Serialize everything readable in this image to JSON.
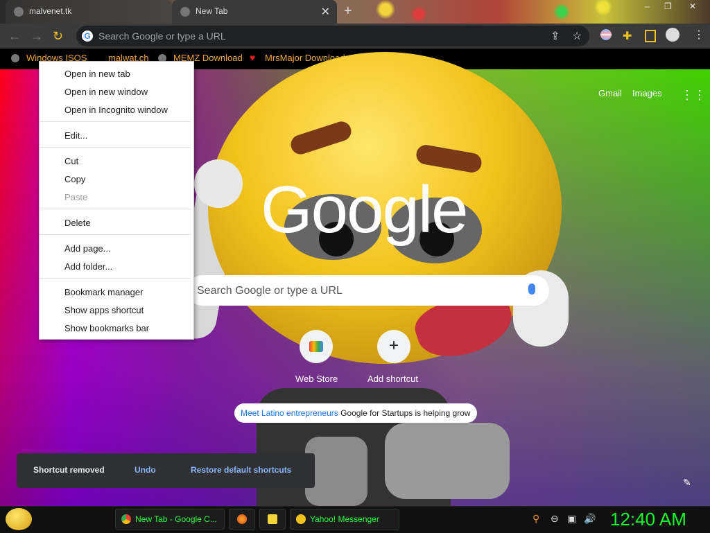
{
  "window": {
    "tabs": [
      {
        "title": "malvenet.tk"
      },
      {
        "title": "New Tab"
      }
    ],
    "new_tab_symbol": "+",
    "close_symbol": "✕",
    "controls": {
      "minimize": "–",
      "maximize": "❐",
      "close": "✕"
    }
  },
  "toolbar": {
    "back": "←",
    "forward": "→",
    "reload": "↻",
    "omnibox_placeholder": "Search Google or type a URL",
    "omnibox_g": "G"
  },
  "bookmarks": [
    {
      "label": "Windows ISOS"
    },
    {
      "label": "malwat.ch"
    },
    {
      "label": "MEMZ Download"
    },
    {
      "label": "MrsMajor Download"
    }
  ],
  "ntp": {
    "header_links": [
      "Gmail",
      "Images"
    ],
    "logo": "Google",
    "search_placeholder": "Search Google or type a URL",
    "shortcuts": [
      {
        "label": "Web Store"
      },
      {
        "label": "Add shortcut"
      }
    ],
    "add_symbol": "+",
    "promo": {
      "link": "Meet Latino entrepreneurs",
      "text": "Google for Startups is helping grow"
    }
  },
  "toast": {
    "message": "Shortcut removed",
    "undo": "Undo",
    "restore": "Restore default shortcuts"
  },
  "context_menu": {
    "groups": [
      [
        {
          "label": "Open in new tab"
        },
        {
          "label": "Open in new window"
        },
        {
          "label": "Open in Incognito window"
        }
      ],
      [
        {
          "label": "Edit..."
        }
      ],
      [
        {
          "label": "Cut"
        },
        {
          "label": "Copy"
        },
        {
          "label": "Paste",
          "disabled": true
        }
      ],
      [
        {
          "label": "Delete"
        }
      ],
      [
        {
          "label": "Add page..."
        },
        {
          "label": "Add folder..."
        }
      ],
      [
        {
          "label": "Bookmark manager"
        },
        {
          "label": "Show apps shortcut"
        },
        {
          "label": "Show bookmarks bar"
        }
      ]
    ]
  },
  "taskbar": {
    "items": [
      {
        "label": "New Tab - Google C..."
      },
      {
        "label": "Yahoo! Messenger"
      }
    ],
    "clock": "12:40 AM"
  },
  "colors": {
    "bookmark_text": "#f0a53a",
    "taskbar_text": "#2cff3c",
    "clock": "#14ff28",
    "toast_link": "#8ab4f8"
  }
}
